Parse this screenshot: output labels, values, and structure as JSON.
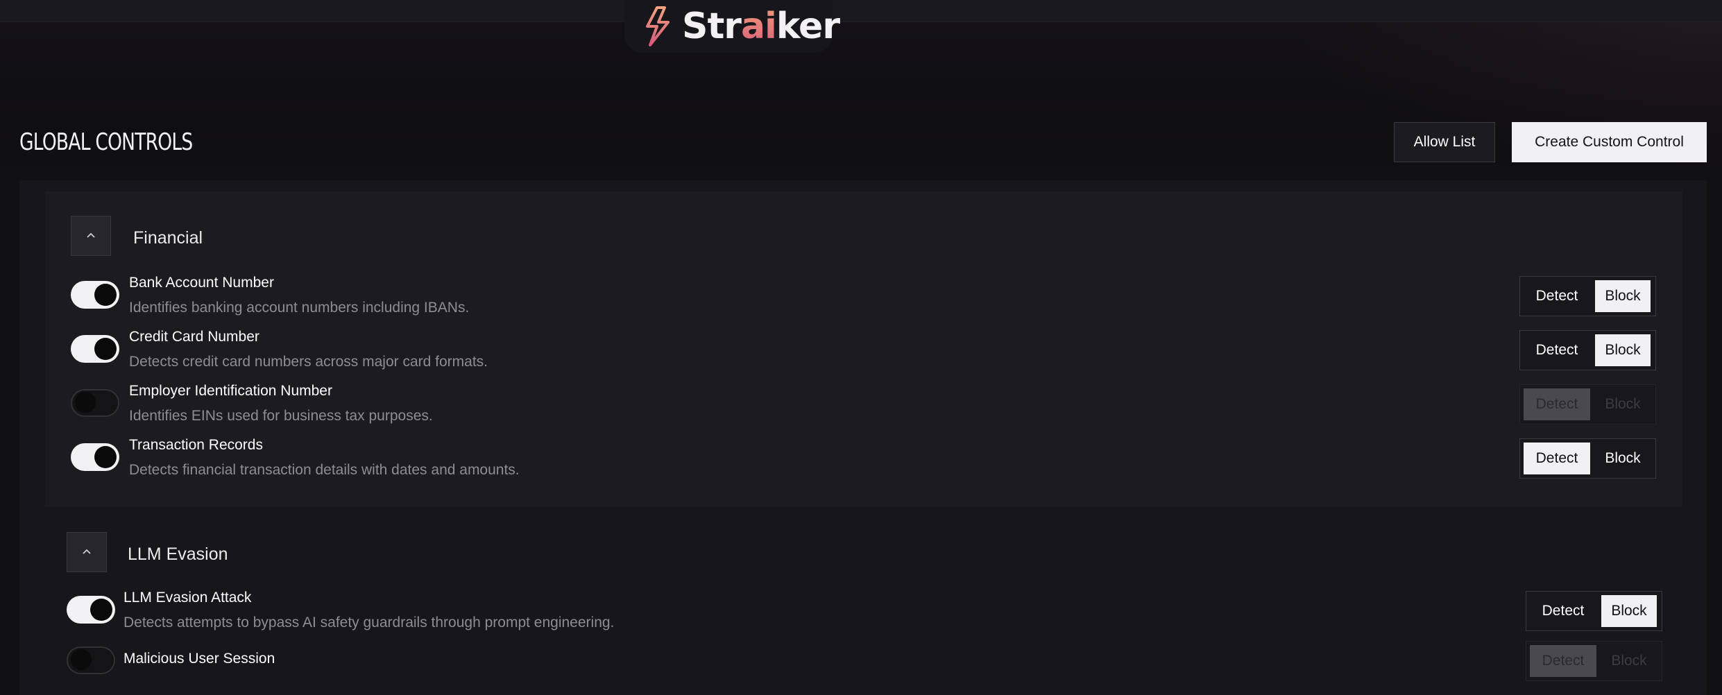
{
  "brand": {
    "name_prefix": "Str",
    "name_accent": "ai",
    "name_suffix": "ker",
    "icon": "lightning-bolt-icon",
    "accent_colors": [
      "#f29a7a",
      "#d9607a"
    ]
  },
  "header": {
    "title": "GLOBAL CONTROLS",
    "allow_list_label": "Allow List",
    "create_label": "Create Custom Control"
  },
  "groups": [
    {
      "title": "Financial",
      "expanded": true,
      "items": [
        {
          "title": "Bank Account Number",
          "description": "Identifies banking account numbers including IBANs.",
          "enabled": true,
          "mode": "Block"
        },
        {
          "title": "Credit Card Number",
          "description": "Detects credit card numbers across major card formats.",
          "enabled": true,
          "mode": "Block"
        },
        {
          "title": "Employer Identification Number",
          "description": "Identifies EINs used for business tax purposes.",
          "enabled": false,
          "mode": "Detect"
        },
        {
          "title": "Transaction Records",
          "description": "Detects financial transaction details with dates and amounts.",
          "enabled": true,
          "mode": "Detect"
        }
      ]
    },
    {
      "title": "LLM Evasion",
      "expanded": true,
      "items": [
        {
          "title": "LLM Evasion Attack",
          "description": "Detects attempts to bypass AI safety guardrails through prompt engineering.",
          "enabled": true,
          "mode": "Block"
        },
        {
          "title": "Malicious User Session",
          "description": "",
          "enabled": false,
          "mode": "Detect"
        }
      ]
    }
  ],
  "segment_labels": {
    "detect": "Detect",
    "block": "Block"
  },
  "icons": {
    "collapse": "chevron-up-icon"
  },
  "colors": {
    "background": "#111013",
    "panel": "#17161a",
    "active_segment": "#f1f1f3",
    "muted_text": "#8e8d93"
  }
}
